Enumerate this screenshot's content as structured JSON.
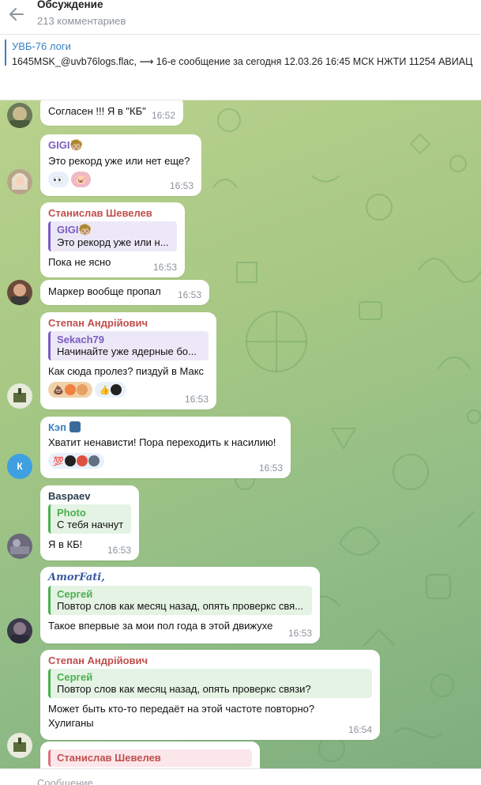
{
  "header": {
    "title": "Обсуждение",
    "subtitle": "213 комментариев"
  },
  "pinned": {
    "title": "УВБ-76 логи",
    "text": "1645MSK_@uvb76logs.flac, ⟿  16-е сообщение за сегодня 12.03.26 16:45 МСК  НЖТИ 11254 АВИАЦ"
  },
  "messages": [
    {
      "text": "Согласен !!! Я в \"КБ\"",
      "time": "16:52"
    },
    {
      "sender": "GIGI🧒🏼",
      "text": "Это рекорд уже или нет еще?",
      "reactions": [
        "👀",
        "🐷"
      ],
      "time": "16:53"
    },
    {
      "sender": "Станислав Шевелев",
      "quote_name": "GIGI🧒🏼",
      "quote_text": "Это рекорд уже или н...",
      "text": "Пока не ясно",
      "time": "16:53"
    },
    {
      "text": "Маркер вообще пропал",
      "time": "16:53"
    },
    {
      "sender": "Степан Андрійович",
      "quote_name": "Sekach79",
      "quote_text": "Начинайте уже ядерные бо...",
      "text": "Как сюда пролез? пиздуй в Макс",
      "reactions": [
        "💩",
        "👍"
      ],
      "time": "16:53"
    },
    {
      "sender": "Кэп",
      "text": "Хватит ненависти! Пора переходить к насилию!",
      "reactions": [
        "💯"
      ],
      "time": "16:53",
      "avatar_letter": "К"
    },
    {
      "sender": "Baspaev",
      "quote_name": "Photo",
      "quote_text": "С тебя начнут",
      "text": "Я в КБ!",
      "time": "16:53"
    },
    {
      "sender": "AmorFati,",
      "quote_name": "Сергей",
      "quote_text": "Повтор слов как месяц назад, опять проверкс свя...",
      "text": "Такое впервые за мои пол года в этой движухе",
      "time": "16:53"
    },
    {
      "sender": "Степан Андрійович",
      "quote_name": "Сергей",
      "quote_text": "Повтор слов как месяц назад, опять проверкс связи?",
      "text": "Может быть кто-то передаёт на этой частоте повторно? Хулиганы",
      "time": "16:54"
    },
    {
      "quote_name": "Станислав Шевелев"
    }
  ],
  "input": {
    "placeholder": "Сообщение"
  },
  "colors": {
    "accent": "#3a7fc0",
    "sender_red": "#c0504d",
    "sender_purple": "#7a5cc0",
    "sender_blue": "#3a7fc0",
    "sender_green": "#4caf50",
    "sender_dark": "#2c3e50"
  }
}
